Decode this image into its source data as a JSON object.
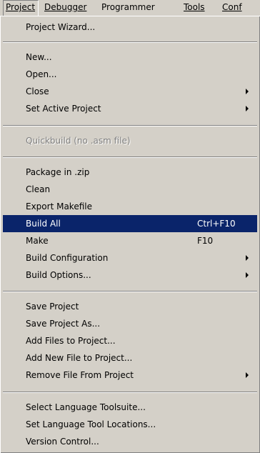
{
  "menubar": {
    "items": [
      {
        "label": "Project",
        "state": "open"
      },
      {
        "label": "Debugger"
      },
      {
        "label": "Programmer"
      },
      {
        "label": "Tools"
      },
      {
        "label": "Conf"
      }
    ]
  },
  "dropdown": {
    "items": [
      {
        "label": "Project Wizard..."
      },
      {
        "label": "New..."
      },
      {
        "label": "Open..."
      },
      {
        "label": "Close",
        "submenu": true
      },
      {
        "label": "Set Active Project",
        "submenu": true
      },
      {
        "label": "Quickbuild (no .asm file)",
        "disabled": true
      },
      {
        "label": "Package in .zip"
      },
      {
        "label": "Clean"
      },
      {
        "label": "Export Makefile"
      },
      {
        "label": "Build All",
        "shortcut": "Ctrl+F10",
        "selected": true
      },
      {
        "label": "Make",
        "shortcut": "F10"
      },
      {
        "label": "Build Configuration",
        "submenu": true
      },
      {
        "label": "Build Options...",
        "submenu": true
      },
      {
        "label": "Save Project"
      },
      {
        "label": "Save Project As..."
      },
      {
        "label": "Add Files to Project..."
      },
      {
        "label": "Add New File to Project..."
      },
      {
        "label": "Remove File From Project",
        "submenu": true
      },
      {
        "label": "Select Language Toolsuite..."
      },
      {
        "label": "Set Language Tool Locations..."
      },
      {
        "label": "Version Control..."
      }
    ]
  },
  "colors": {
    "menu_background": "#d4d0c8",
    "highlight": "#0a246a",
    "highlight_text": "#ffffff",
    "disabled_text": "#808080"
  }
}
